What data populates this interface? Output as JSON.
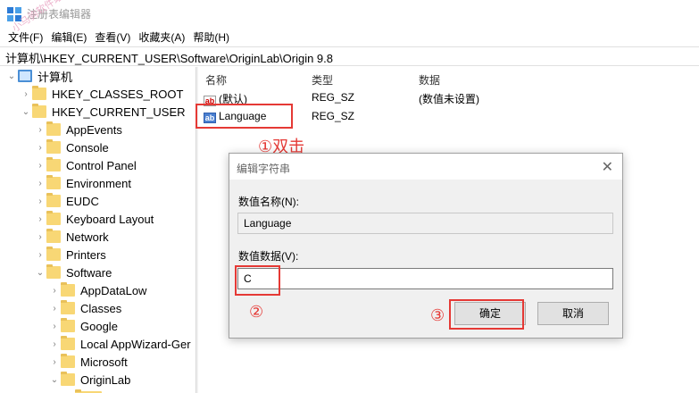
{
  "window": {
    "title": "注册表编辑器",
    "watermark": "小马驹软件站"
  },
  "menu": [
    "文件(F)",
    "编辑(E)",
    "查看(V)",
    "收藏夹(A)",
    "帮助(H)"
  ],
  "address": "计算机\\HKEY_CURRENT_USER\\Software\\OriginLab\\Origin 9.8",
  "tree": [
    {
      "label": "计算机",
      "chevron": "down",
      "icon": "computer-icon"
    },
    {
      "label": "HKEY_CLASSES_ROOT",
      "chevron": "right"
    },
    {
      "label": "HKEY_CURRENT_USER",
      "chevron": "down"
    },
    {
      "label": "AppEvents",
      "chevron": "right"
    },
    {
      "label": "Console",
      "chevron": "right"
    },
    {
      "label": "Control Panel",
      "chevron": "right"
    },
    {
      "label": "Environment",
      "chevron": "right"
    },
    {
      "label": "EUDC",
      "chevron": "right"
    },
    {
      "label": "Keyboard Layout",
      "chevron": "right"
    },
    {
      "label": "Network",
      "chevron": "right"
    },
    {
      "label": "Printers",
      "chevron": "right"
    },
    {
      "label": "Software",
      "chevron": "down"
    },
    {
      "label": "AppDataLow",
      "chevron": "right"
    },
    {
      "label": "Classes",
      "chevron": "right"
    },
    {
      "label": "Google",
      "chevron": "right"
    },
    {
      "label": "Local AppWizard-Ger",
      "chevron": "right"
    },
    {
      "label": "Microsoft",
      "chevron": "right"
    },
    {
      "label": "OriginLab",
      "chevron": "down"
    }
  ],
  "list": {
    "headers": {
      "name": "名称",
      "type": "类型",
      "data": "数据"
    },
    "rows": [
      {
        "name": "(默认)",
        "type": "REG_SZ",
        "data": "(数值未设置)"
      },
      {
        "name": "Language",
        "type": "REG_SZ",
        "data": ""
      }
    ]
  },
  "annotations": {
    "step1": "①双击",
    "step2": "②",
    "step3": "③"
  },
  "dialog": {
    "title": "编辑字符串",
    "name_label": "数值名称(N):",
    "name_value": "Language",
    "data_label": "数值数据(V):",
    "data_value": "C",
    "ok_label": "确定",
    "cancel_label": "取消"
  },
  "colors": {
    "annotation": "#e53935",
    "folder": "#f8d775"
  }
}
